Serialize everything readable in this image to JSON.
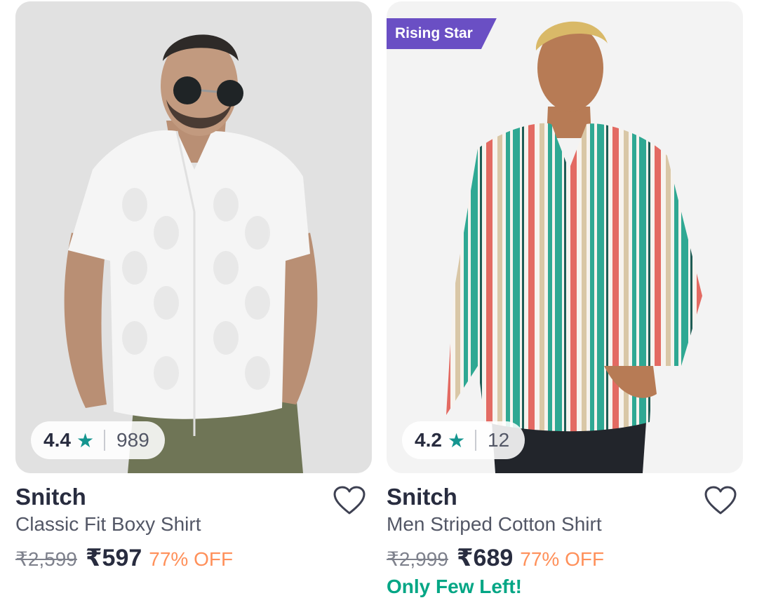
{
  "products": [
    {
      "badge": "",
      "rating": "4.4",
      "rating_count": "989",
      "brand": "Snitch",
      "title": "Classic Fit Boxy Shirt",
      "mrp": "₹2,599",
      "price": "₹597",
      "discount": "77% OFF",
      "stock_note": ""
    },
    {
      "badge": "Rising Star",
      "rating": "4.2",
      "rating_count": "12",
      "brand": "Snitch",
      "title": "Men Striped Cotton Shirt",
      "mrp": "₹2,999",
      "price": "₹689",
      "discount": "77% OFF",
      "stock_note": "Only Few Left!"
    }
  ],
  "icons": {
    "rating_star": "★",
    "wishlist": "heart-outline-icon"
  },
  "colors": {
    "rating_star": "#14958f",
    "discount": "#ff905a",
    "stock_note": "#03a685",
    "badge_bg": "#6a4fc4"
  }
}
